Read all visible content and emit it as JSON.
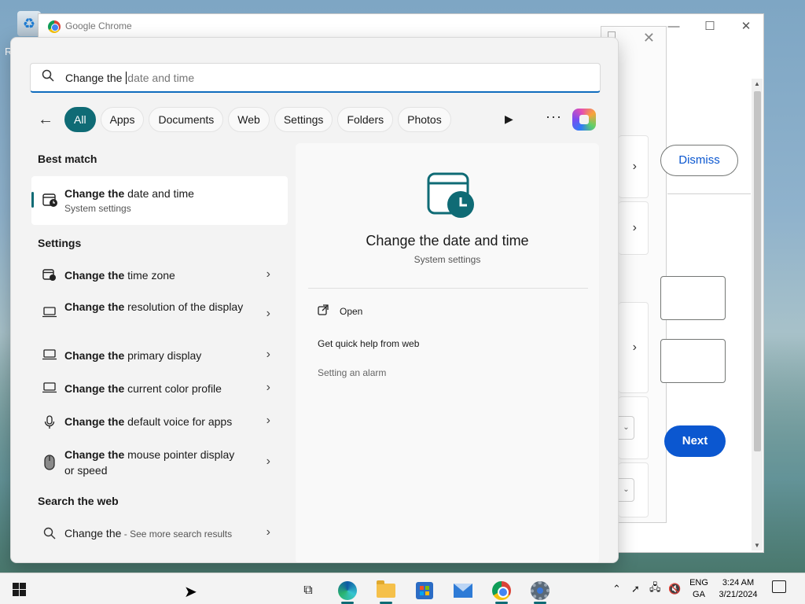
{
  "desktop": {
    "partial_label": "R"
  },
  "chrome": {
    "title": "Google Chrome",
    "minimize_icon": "minimize-icon",
    "maximize_icon": "maximize-icon",
    "close_icon": "close-icon",
    "dismiss_label": "Dismiss",
    "next_label": "Next"
  },
  "search": {
    "typed": "Change the ",
    "suggestion": "date and time",
    "filters": [
      "All",
      "Apps",
      "Documents",
      "Web",
      "Settings",
      "Folders",
      "Photos"
    ],
    "active_filter": "All"
  },
  "results": {
    "best_match_heading": "Best match",
    "best_match": {
      "bold": "Change the",
      "rest": " date and time",
      "subtitle": "System settings",
      "icon": "date-time-icon"
    },
    "settings_heading": "Settings",
    "settings_items": [
      {
        "bold": "Change the",
        "rest": " time zone",
        "icon": "clock-calendar-icon"
      },
      {
        "bold": "Change the",
        "rest": " resolution of the display",
        "icon": "laptop-icon"
      },
      {
        "bold": "Change the",
        "rest": " primary display",
        "icon": "laptop-icon"
      },
      {
        "bold": "Change the",
        "rest": " current color profile",
        "icon": "laptop-icon"
      },
      {
        "bold": "Change the",
        "rest": " default voice for apps",
        "icon": "microphone-icon"
      },
      {
        "bold": "Change the",
        "rest": " mouse pointer display or speed",
        "icon": "mouse-icon"
      }
    ],
    "web_heading": "Search the web",
    "web_item": {
      "text": "Change the",
      "suffix": " - See more search results",
      "icon": "search-icon"
    }
  },
  "preview": {
    "title": "Change the date and time",
    "subtitle": "System settings",
    "open_label": "Open",
    "help_label": "Get quick help from web",
    "related_label": "Setting an alarm"
  },
  "taskbar": {
    "apps": [
      "task-view",
      "edge",
      "file-explorer",
      "microsoft-store",
      "mail",
      "chrome",
      "settings"
    ],
    "lang_top": "ENG",
    "lang_bottom": "GA",
    "time": "3:24 AM",
    "date": "3/21/2024"
  },
  "colors": {
    "accent": "#0f6b75",
    "search_underline": "#0f6cbd",
    "google_blue": "#0b57d0"
  }
}
